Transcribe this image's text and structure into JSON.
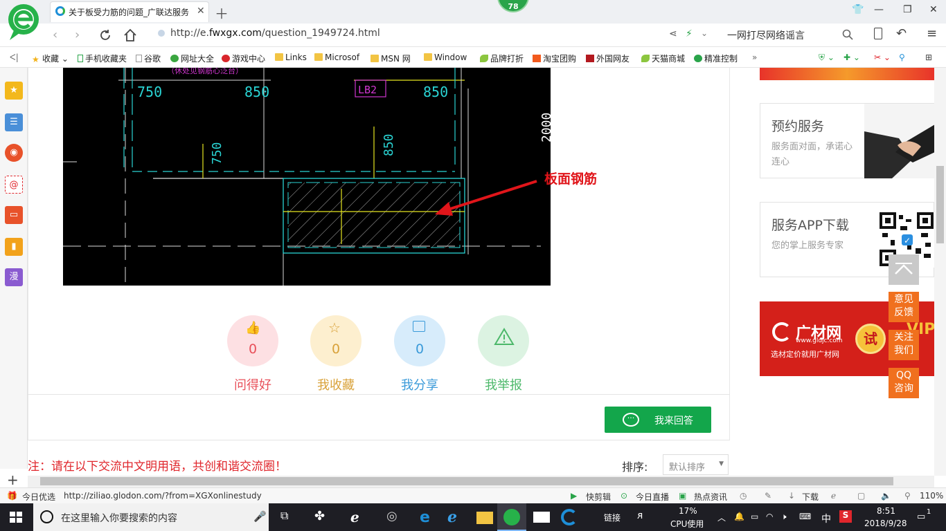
{
  "browser": {
    "tab_title": "关于板受力筋的问题_广联达服务",
    "badge": "78",
    "url_prefix": "http://e.",
    "url_host": "fwxgx.com",
    "url_path": "/question_1949724.html",
    "search_hint": "一网打尽网络谣言"
  },
  "bookmarks": [
    {
      "label": "收藏",
      "icon": "star-icon"
    },
    {
      "label": "手机收藏夹",
      "icon": "phone-icon"
    },
    {
      "label": "谷歌",
      "icon": "page-icon"
    },
    {
      "label": "网址大全",
      "icon": "globe-icon"
    },
    {
      "label": "游戏中心",
      "icon": "game-icon"
    },
    {
      "label": "Links",
      "icon": "folder-icon"
    },
    {
      "label": "Microsof",
      "icon": "folder-icon"
    },
    {
      "label": "MSN 网",
      "icon": "folder-icon"
    },
    {
      "label": "Window",
      "icon": "folder-icon"
    },
    {
      "label": "品牌打折",
      "icon": "leaf-icon"
    },
    {
      "label": "淘宝团购",
      "icon": "taobao-icon"
    },
    {
      "label": "外国网友",
      "icon": "bookmark-icon"
    },
    {
      "label": "天猫商城",
      "icon": "leaf-icon"
    },
    {
      "label": "精准控制",
      "icon": "chat-icon"
    }
  ],
  "cad": {
    "dims": [
      "750",
      "850",
      "850",
      "750",
      "850",
      "2000"
    ],
    "tag": "LB2",
    "top_note": "（休处见钢筋心泛台）"
  },
  "annotation": "板面钢筋",
  "actions": [
    {
      "label": "问得好",
      "count": "0",
      "color": "#e8505a",
      "bg": "#fde0e3"
    },
    {
      "label": "我收藏",
      "count": "0",
      "color": "#d9a23a",
      "bg": "#fdefcf"
    },
    {
      "label": "我分享",
      "count": "0",
      "color": "#3a9ad9",
      "bg": "#d7ecfb"
    },
    {
      "label": "我举报",
      "count": "0",
      "color": "#4cb86a",
      "bg": "#dcf3e2"
    }
  ],
  "reply_button": "我来回答",
  "notice": "注：请在以下交流中文明用语，共创和谐交流圈！",
  "sort": {
    "label": "排序:",
    "value": "默认排序"
  },
  "right": {
    "card1": {
      "title": "预约服务",
      "desc": "服务面对面，承诺心连心"
    },
    "card2": {
      "title": "服务APP下载",
      "desc": "您的掌上服务专家"
    },
    "gcai": {
      "name": "广材网",
      "site": "www.gldjc.com",
      "slogan": "选材定价就用广材网",
      "try": "试",
      "vip": "VIP"
    }
  },
  "feedback": [
    {
      "label": "意见反馈"
    },
    {
      "label": "关注我们"
    },
    {
      "label": "QQ咨询"
    }
  ],
  "status": {
    "today": "今日优选",
    "link": "http://ziliao.glodon.com/?from=XGXonlinestudy",
    "items": [
      "快剪辑",
      "今日直播",
      "热点资讯",
      "下载"
    ],
    "zoom": "110%"
  },
  "taskbar": {
    "search_placeholder": "在这里输入你要搜索的内容",
    "link": "链接",
    "cpu": "17%",
    "cpu_label": "CPU使用",
    "ime": "中",
    "time": "8:51",
    "date": "2018/9/28",
    "notif": "1"
  }
}
